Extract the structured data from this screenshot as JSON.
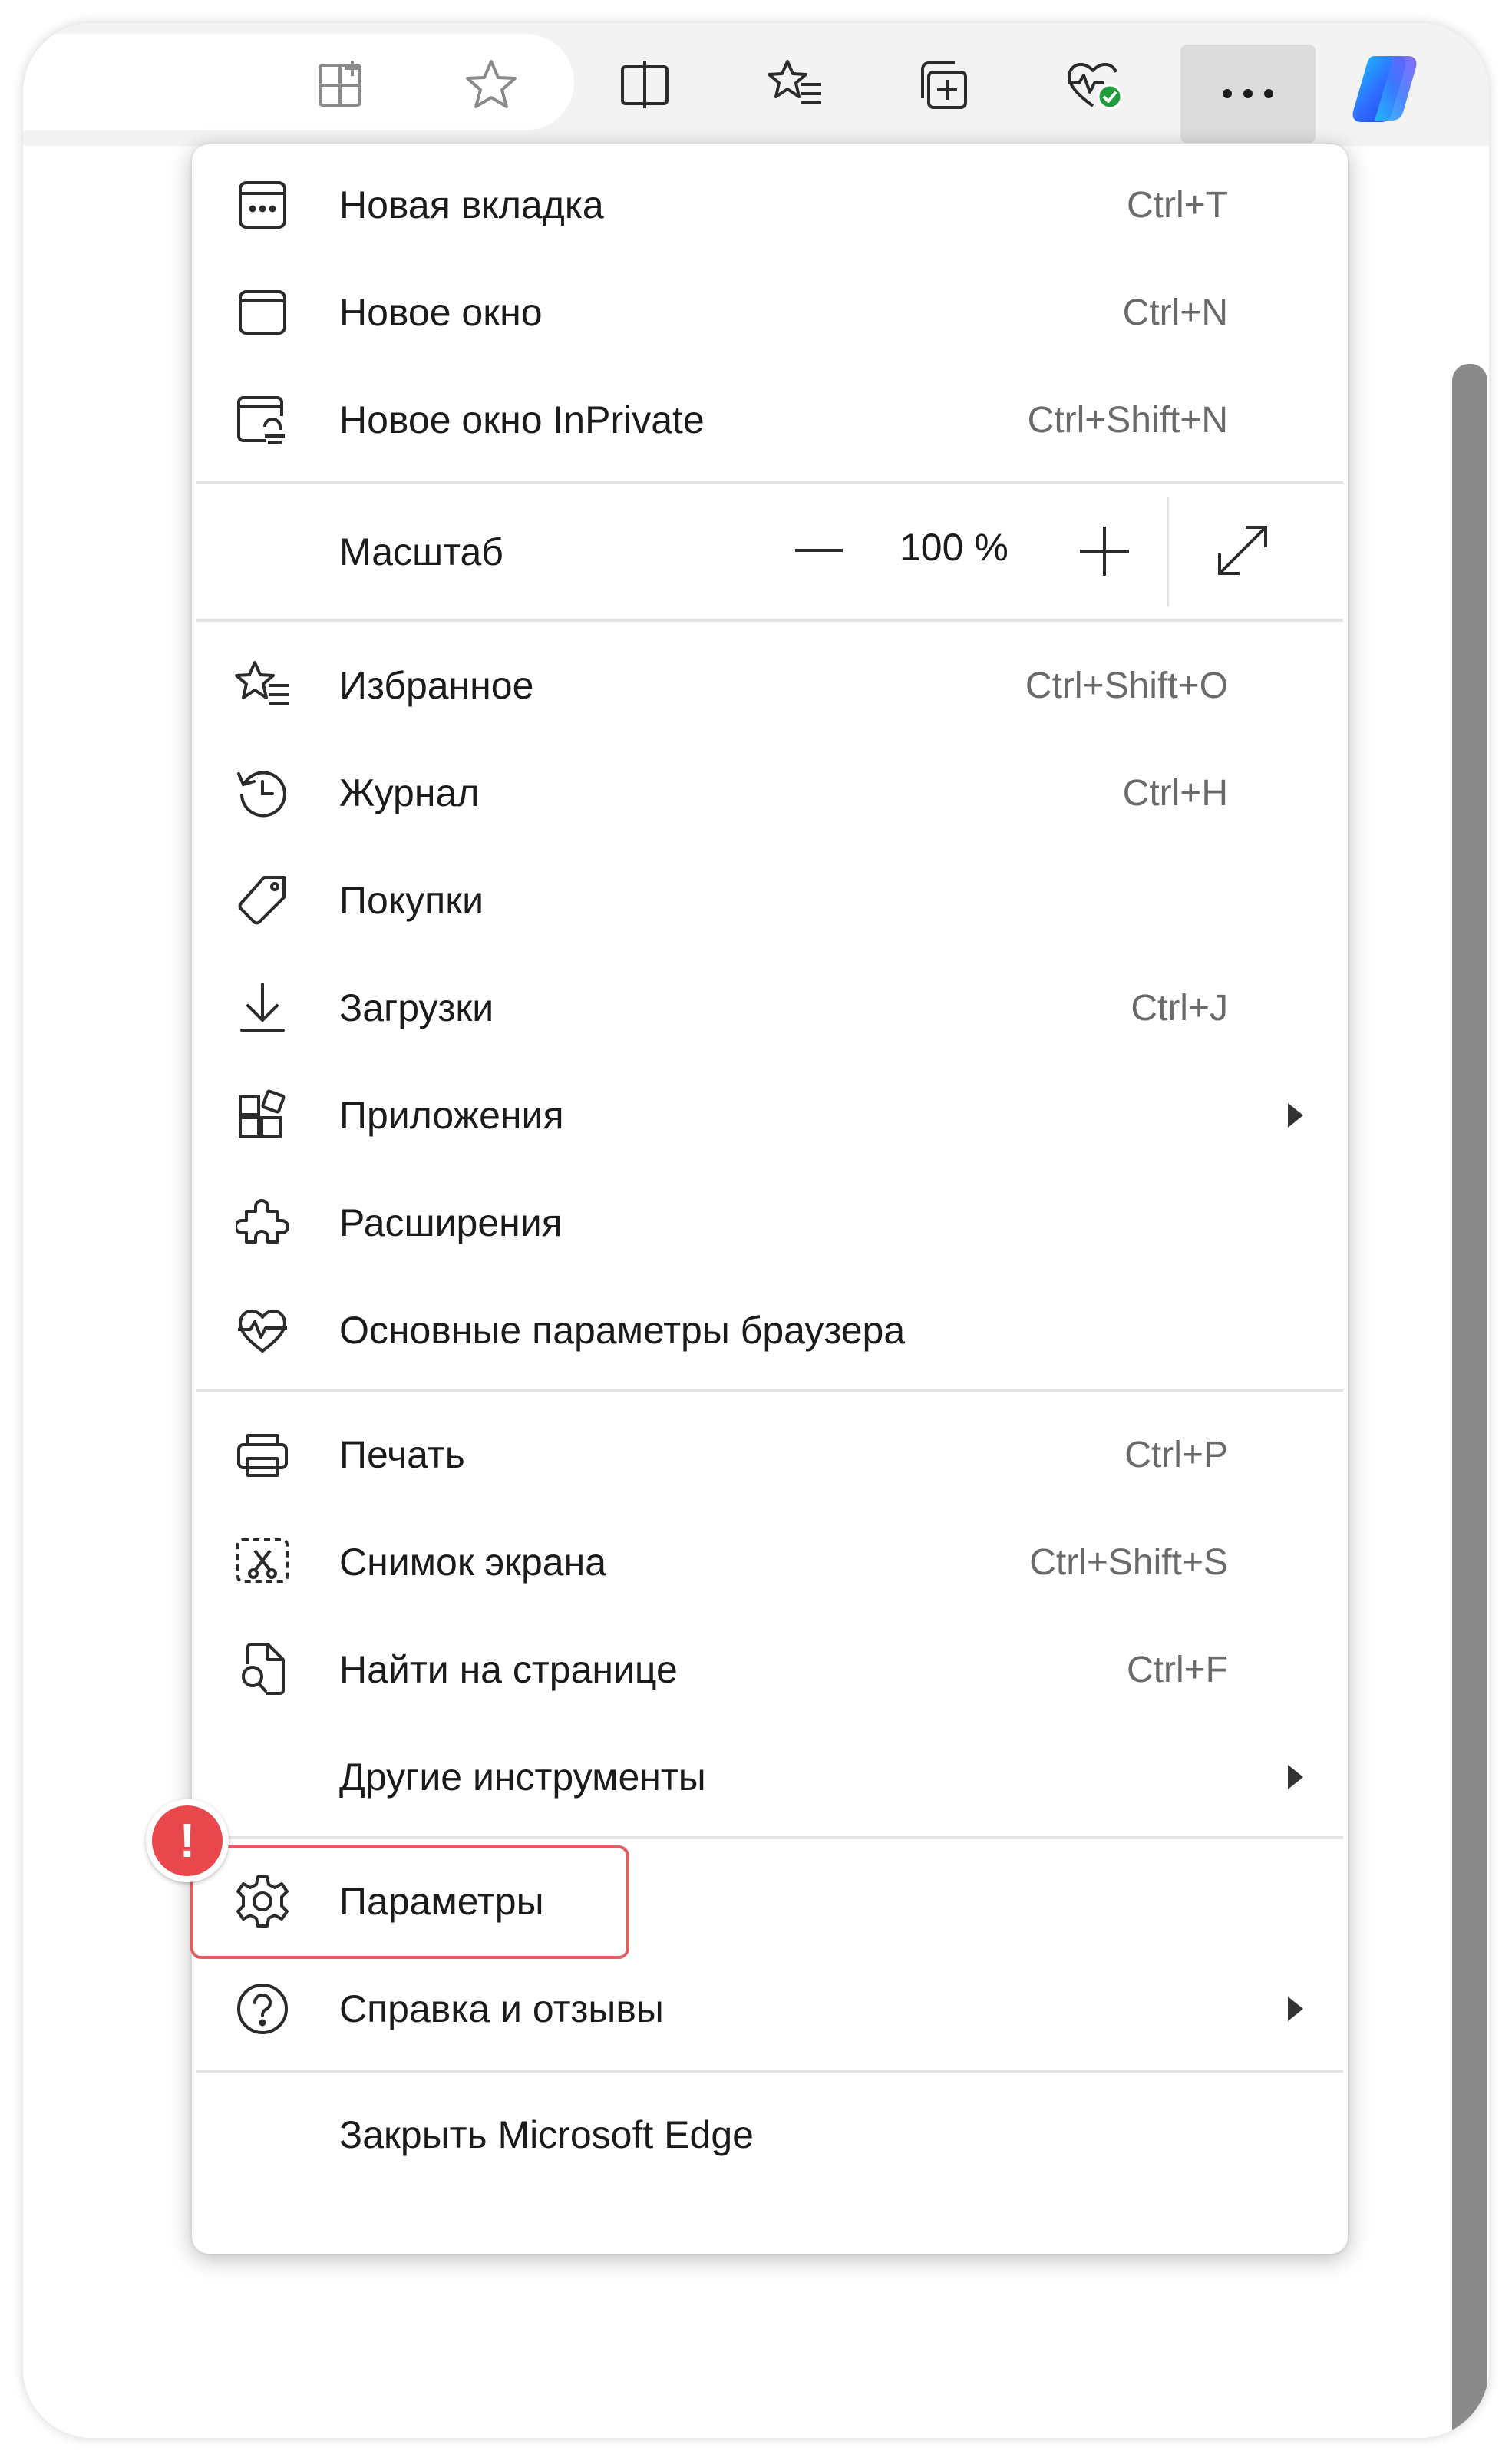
{
  "colors": {
    "accent_highlight": "#e35d63",
    "badge": "#e8484b",
    "menu_bg": "#ffffff",
    "toolbar_bg": "#f3f3f3",
    "more_button_bg": "#dcdcdc",
    "extension_check": "#1f9d3a"
  },
  "toolbar": {
    "icons": [
      "split-screen-add-icon",
      "favorite-star-icon",
      "split-screen-icon",
      "favorites-list-icon",
      "collections-icon",
      "browser-essentials-icon",
      "more-options-icon",
      "copilot-icon"
    ]
  },
  "menu": {
    "group1": [
      {
        "label": "Новая вкладка",
        "shortcut": "Ctrl+T",
        "icon": "new-tab-icon"
      },
      {
        "label": "Новое окно",
        "shortcut": "Ctrl+N",
        "icon": "new-window-icon"
      },
      {
        "label": "Новое окно InPrivate",
        "shortcut": "Ctrl+Shift+N",
        "icon": "inprivate-window-icon"
      }
    ],
    "zoom": {
      "label": "Масштаб",
      "value": "100 %",
      "minus": "—",
      "plus": "+"
    },
    "group2": [
      {
        "label": "Избранное",
        "shortcut": "Ctrl+Shift+O",
        "icon": "favorites-icon"
      },
      {
        "label": "Журнал",
        "shortcut": "Ctrl+H",
        "icon": "history-icon"
      },
      {
        "label": "Покупки",
        "shortcut": "",
        "icon": "shopping-tag-icon"
      },
      {
        "label": "Загрузки",
        "shortcut": "Ctrl+J",
        "icon": "downloads-icon"
      },
      {
        "label": "Приложения",
        "shortcut": "",
        "icon": "apps-icon",
        "submenu": true
      },
      {
        "label": "Расширения",
        "shortcut": "",
        "icon": "extensions-icon"
      },
      {
        "label": "Основные параметры браузера",
        "shortcut": "",
        "icon": "browser-essentials-icon"
      }
    ],
    "group3": [
      {
        "label": "Печать",
        "shortcut": "Ctrl+P",
        "icon": "print-icon"
      },
      {
        "label": "Снимок экрана",
        "shortcut": "Ctrl+Shift+S",
        "icon": "screenshot-icon"
      },
      {
        "label": "Найти на странице",
        "shortcut": "Ctrl+F",
        "icon": "find-on-page-icon"
      },
      {
        "label": "Другие инструменты",
        "shortcut": "",
        "icon": "",
        "submenu": true
      }
    ],
    "group4": [
      {
        "label": "Параметры",
        "shortcut": "",
        "icon": "settings-gear-icon",
        "highlighted": true
      },
      {
        "label": "Справка и отзывы",
        "shortcut": "",
        "icon": "help-icon",
        "submenu": true
      }
    ],
    "group5": [
      {
        "label": "Закрыть Microsoft Edge",
        "shortcut": ""
      }
    ]
  },
  "badge": {
    "text": "!"
  }
}
